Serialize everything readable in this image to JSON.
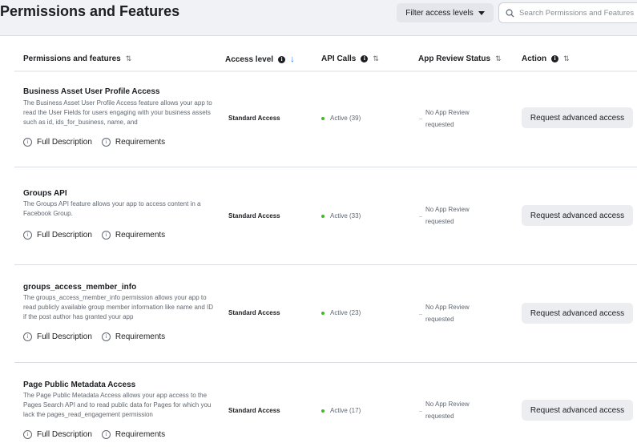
{
  "page": {
    "title": "Permissions and Features",
    "filter_label": "Filter access levels",
    "search_placeholder": "Search Permissions and Features"
  },
  "table": {
    "columns": [
      {
        "label": "Permissions and features",
        "sort": "⇅"
      },
      {
        "label": "Access level",
        "sort": "↓"
      },
      {
        "label": "API Calls",
        "sort": "⇅"
      },
      {
        "label": "App Review Status",
        "sort": "⇅"
      },
      {
        "label": "Action",
        "sort": "⇅"
      }
    ],
    "link_full_description": "Full Description",
    "link_requirements": "Requirements",
    "rows": [
      {
        "title": "Business Asset User Profile Access",
        "description": "The Business Asset User Profile Access feature allows your app to read the User Fields for users engaging with your business assets such as id, ids_for_business, name, and",
        "access_level": "Standard Access",
        "api_calls": "Active (39)",
        "review_line1": "No App Review",
        "review_line2": "requested",
        "action": "Request advanced access"
      },
      {
        "title": "Groups API",
        "description": "The Groups API feature allows your app to access content in a Facebook Group.",
        "access_level": "Standard Access",
        "api_calls": "Active (33)",
        "review_line1": "No App Review",
        "review_line2": "requested",
        "action": "Request advanced access"
      },
      {
        "title": "groups_access_member_info",
        "description": "The groups_access_member_info permission allows your app to read publicly available group member information like name and ID if the post author has granted your app",
        "access_level": "Standard Access",
        "api_calls": "Active (23)",
        "review_line1": "No App Review",
        "review_line2": "requested",
        "action": "Request advanced access"
      },
      {
        "title": "Page Public Metadata Access",
        "description": "The Page Public Metadata Access allows your app access to the Pages Search API and to read public data for Pages for which you lack the pages_read_engagement permission",
        "access_level": "Standard Access",
        "api_calls": "Active (17)",
        "review_line1": "No App Review",
        "review_line2": "requested",
        "action": "Request advanced access"
      }
    ]
  },
  "icons": {
    "info": "i",
    "circle_info": "i"
  },
  "colors": {
    "active_dot": "#42b72a",
    "sort_active": "#1877f2",
    "page_bg": "#f0f2f5"
  }
}
